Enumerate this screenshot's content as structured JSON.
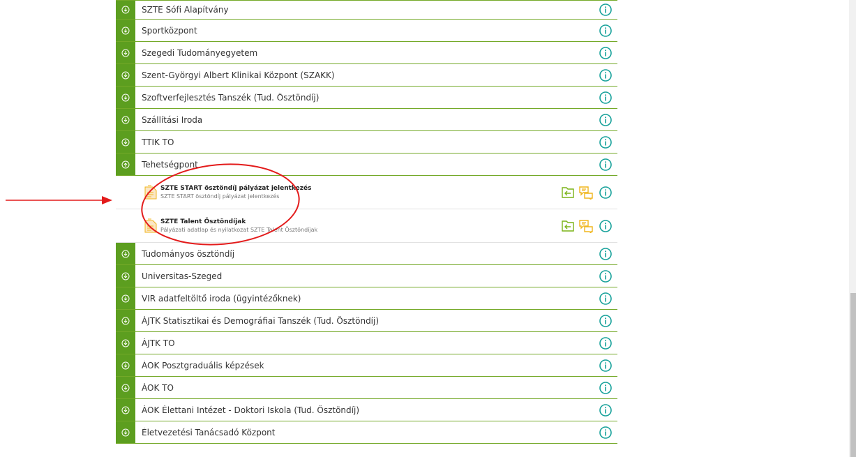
{
  "groups_top": [
    {
      "label": "SZTE Sófi Alapítvány"
    },
    {
      "label": "Sportközpont"
    },
    {
      "label": "Szegedi Tudományegyetem"
    },
    {
      "label": "Szent-Györgyi Albert Klinikai Központ (SZAKK)"
    },
    {
      "label": "Szoftverfejlesztés Tanszék (Tud. Ösztöndíj)"
    },
    {
      "label": "Szállítási Iroda"
    },
    {
      "label": "TTIK TO"
    }
  ],
  "expanded_group": {
    "label": "Tehetségpont",
    "items": [
      {
        "title": "SZTE START ösztöndíj pályázat jelentkezés",
        "subtitle": "SZTE START ösztöndíj pályázat jelentkezés"
      },
      {
        "title": "SZTE Talent Ösztöndíjak",
        "subtitle": "Pályázati adatlap és nyilatkozat SZTE Talent Ösztöndíjak"
      }
    ]
  },
  "groups_bottom": [
    {
      "label": "Tudományos ösztöndíj"
    },
    {
      "label": "Universitas-Szeged"
    },
    {
      "label": "VIR adatfeltöltő iroda (ügyintézőknek)"
    },
    {
      "label": "ÁJTK Statisztikai és Demográfiai Tanszék (Tud. Ösztöndíj)"
    },
    {
      "label": "ÁJTK TO"
    },
    {
      "label": "ÁOK Posztgraduális képzések"
    },
    {
      "label": "ÁOK TO"
    },
    {
      "label": "ÁOK Élettani Intézet - Doktori Iskola (Tud. Ösztöndíj)"
    },
    {
      "label": "Életvezetési Tanácsadó Központ"
    }
  ],
  "colors": {
    "group_green": "#5c9e1f",
    "divider_green": "#74a928",
    "info_teal": "#16a19a",
    "action_green": "#7ab317",
    "action_yellow": "#f0b51c",
    "annotation_red": "#e31b1b"
  },
  "icons": {
    "collapsed": "chevron-down-circle-icon",
    "expanded": "chevron-up-circle-icon",
    "info": "info-circle-icon",
    "document": "document-icon",
    "open_form": "folder-arrow-icon",
    "messages": "chat-bubbles-icon"
  }
}
